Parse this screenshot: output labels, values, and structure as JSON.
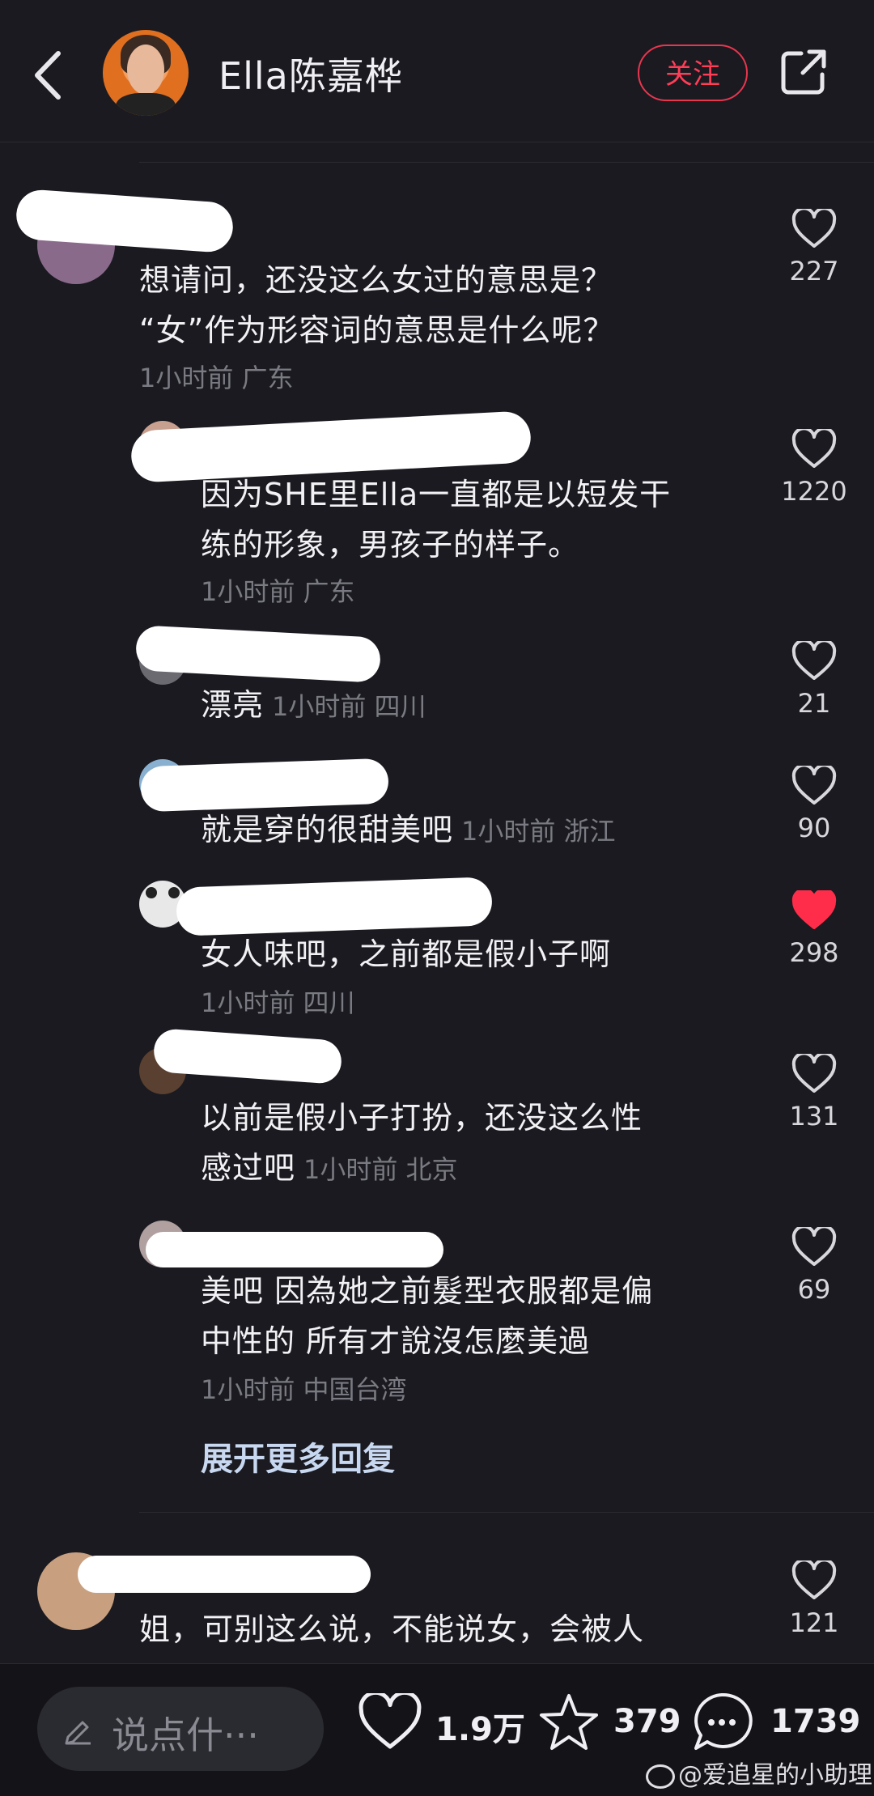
{
  "header": {
    "title": "Ella陈嘉桦",
    "follow_label": "关注"
  },
  "comments": [
    {
      "text_lines": [
        "想请问，还没这么女过的意思是？",
        "“女”作为形容词的意思是什么呢？"
      ],
      "meta": "1小时前  广东",
      "likes": "227",
      "liked": false
    },
    {
      "text_lines": [
        "因为SHE里Ella一直都是以短发干",
        "练的形象，男孩子的样子。"
      ],
      "meta": "1小时前  广东",
      "likes": "1220",
      "liked": false
    },
    {
      "text": "漂亮",
      "meta": "1小时前  四川",
      "likes": "21",
      "liked": false
    },
    {
      "text": "就是穿的很甜美吧",
      "meta": "1小时前  浙江",
      "likes": "90",
      "liked": false
    },
    {
      "text": "女人味吧，之前都是假小子啊",
      "meta": "1小时前  四川",
      "likes": "298",
      "liked": true
    },
    {
      "text_lines": [
        "以前是假小子打扮，还没这么性",
        "感过吧"
      ],
      "meta": "1小时前  北京",
      "likes": "131",
      "liked": false
    },
    {
      "text_lines": [
        "美吧 因為她之前髮型衣服都是偏",
        "中性的 所有才說沒怎麼美過"
      ],
      "meta": "1小时前  中国台湾",
      "likes": "69",
      "liked": false
    },
    {
      "text": "姐，可别这么说，不能说女，会被人",
      "likes": "121",
      "liked": false
    }
  ],
  "expand_label": "展开更多回复",
  "bottom": {
    "input_placeholder": "说点什···",
    "likes": "1.9万",
    "favorites": "379",
    "comments": "1739"
  },
  "watermark": "@爱追星的小助理",
  "colors": {
    "background": "#1a1a20",
    "accent": "#ff3d57",
    "liked_heart": "#ff2d4a"
  },
  "icons": [
    "back-icon",
    "share-icon",
    "heart-icon",
    "star-icon",
    "comment-bubble-icon",
    "pen-icon",
    "weibo-icon"
  ]
}
